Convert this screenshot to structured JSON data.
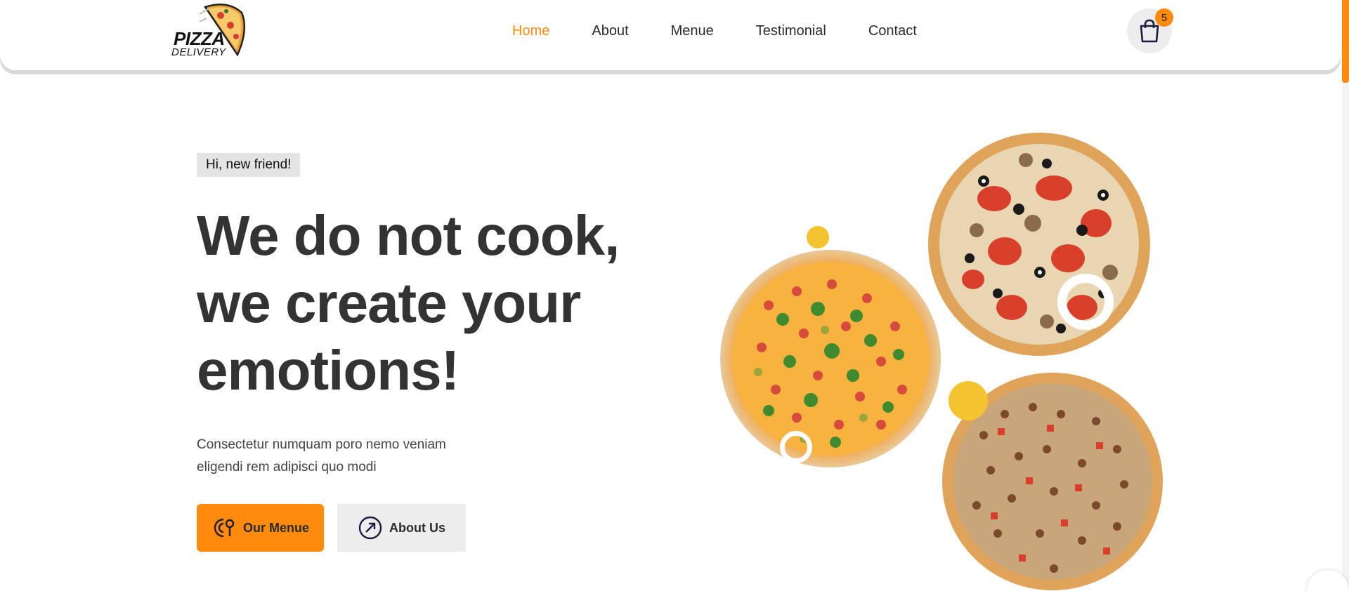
{
  "brand": {
    "logo_line1": "PIZZA",
    "logo_line2": "DELIVERY"
  },
  "nav": {
    "items": [
      {
        "label": "Home",
        "active": true
      },
      {
        "label": "About",
        "active": false
      },
      {
        "label": "Menue",
        "active": false
      },
      {
        "label": "Testimonial",
        "active": false
      },
      {
        "label": "Contact",
        "active": false
      }
    ]
  },
  "cart": {
    "icon": "shopping-bag-icon",
    "count": "5"
  },
  "hero": {
    "tag": "Hi, new friend!",
    "headline_line1": "We do not cook,",
    "headline_line2": "we create your",
    "headline_line3": "emotions!",
    "subtext_line1": "Consectetur numquam poro nemo veniam",
    "subtext_line2": "eligendi rem adipisci quo modi",
    "btn_menu_label": "Our Menue",
    "btn_menu_icon": "menu-icon",
    "btn_about_label": "About Us",
    "btn_about_icon": "arrow-up-right-icon"
  },
  "colors": {
    "accent": "#ff8a0c",
    "dot": "#f4c430",
    "text": "#333333",
    "tag_bg": "#e4e4e4"
  }
}
